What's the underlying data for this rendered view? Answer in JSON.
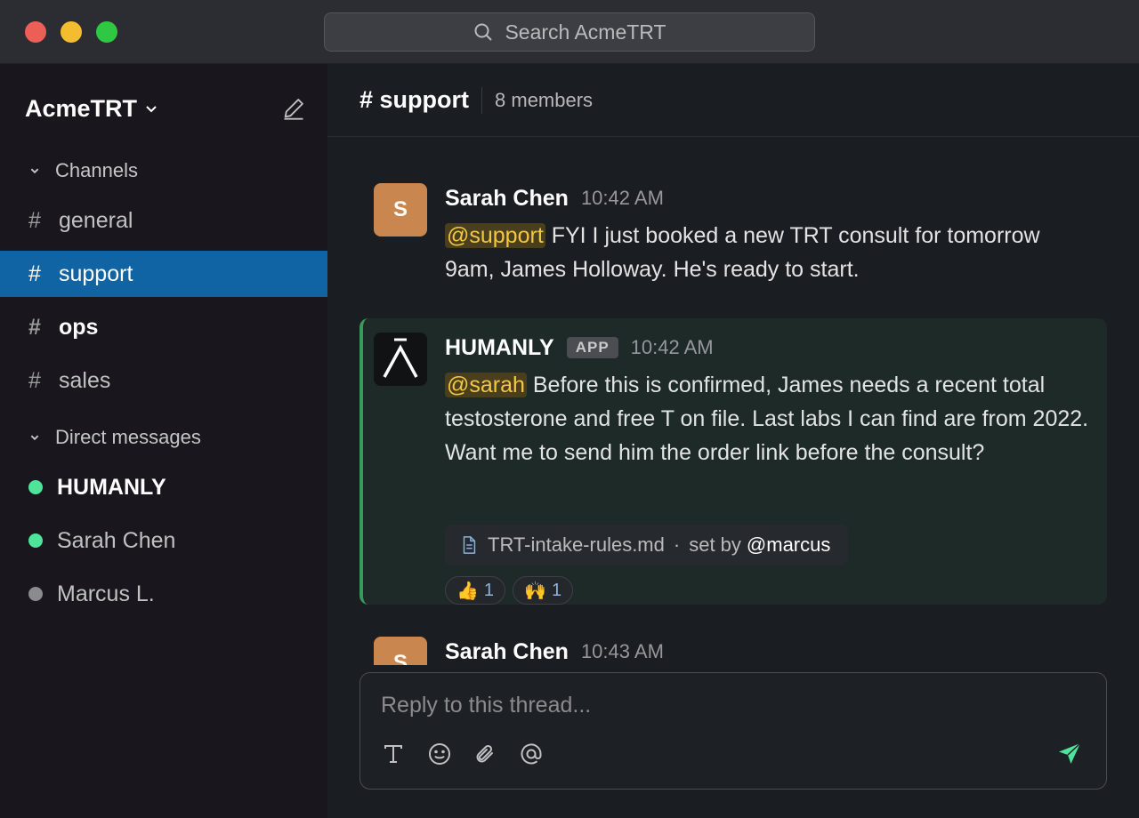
{
  "search": {
    "placeholder": "Search AcmeTRT"
  },
  "workspace": {
    "name": "AcmeTRT"
  },
  "sidebar": {
    "channels_heading": "Channels",
    "channels": [
      {
        "name": "general"
      },
      {
        "name": "support"
      },
      {
        "name": "ops"
      },
      {
        "name": "sales"
      }
    ],
    "dms_heading": "Direct messages",
    "dms": [
      {
        "name": "HUMANLY",
        "status": "online"
      },
      {
        "name": "Sarah Chen",
        "status": "online"
      },
      {
        "name": "Marcus L.",
        "status": "away"
      }
    ]
  },
  "channel": {
    "title": "# support",
    "members": "8 members"
  },
  "messages": [
    {
      "avatar": "S",
      "author": "Sarah Chen",
      "time": "10:42 AM",
      "mention": "@support",
      "text": " FYI I just booked a new TRT consult for tomorrow 9am, James Holloway. He's ready to start."
    },
    {
      "author": "HUMANLY",
      "badge": "APP",
      "time": "10:42 AM",
      "mention": "@sarah",
      "text": " Before this is confirmed, James needs a recent total testosterone and free T on file. Last labs I can find are from 2022. Want me to send him the order link before the consult?",
      "attachment": {
        "file": "TRT-intake-rules.md",
        "separator": "·",
        "set_by": "set by",
        "user": "@marcus"
      },
      "reactions": [
        {
          "emoji": "👍",
          "count": "1"
        },
        {
          "emoji": "🙌",
          "count": "1"
        }
      ]
    },
    {
      "avatar": "S",
      "author": "Sarah Chen",
      "time": "10:43 AM"
    }
  ],
  "composer": {
    "placeholder": "Reply to this thread..."
  },
  "colors": {
    "accent": "#1164a3",
    "online": "#4ee49a",
    "away": "#8a8b8e",
    "mention_bg": "#4a3f1c",
    "mention_fg": "#f2c744",
    "send": "#4ee49a"
  }
}
